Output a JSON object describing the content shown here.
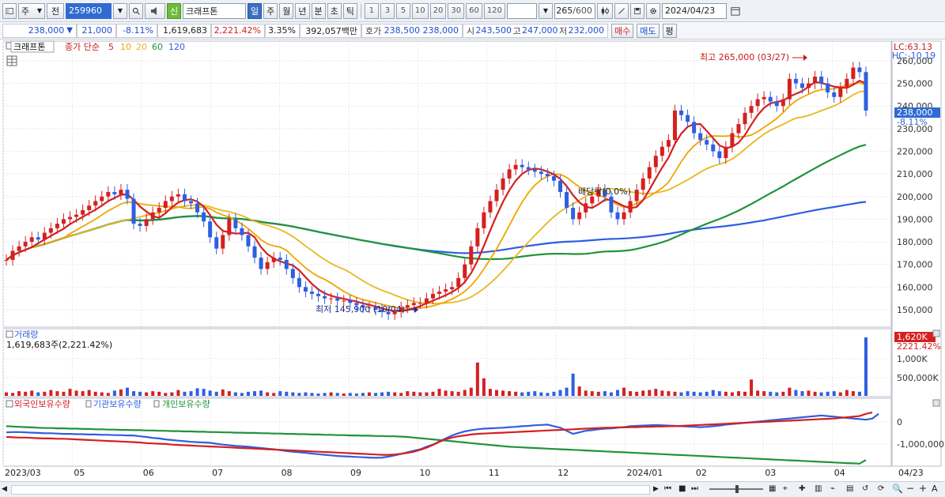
{
  "toolbar": {
    "period_type": "주",
    "prev_label": "전",
    "code": "259960",
    "stock_badge": "신",
    "stock_name": "크래프톤",
    "tabs": [
      "일",
      "주",
      "월",
      "년",
      "분",
      "초",
      "틱"
    ],
    "selected_tab": "일",
    "intervals": [
      "1",
      "3",
      "5",
      "10",
      "20",
      "30",
      "60",
      "120"
    ],
    "count": "265",
    "count_total": "/600",
    "date": "2024/04/23"
  },
  "quote": {
    "price": "238,000",
    "change": "21,000",
    "rate": "-8.11%",
    "volume": "1,619,683",
    "volume_rate": "2,221.42%",
    "turnover": "3.35%",
    "amount": "392,057백만",
    "ask_label": "호가",
    "ask": "238,500",
    "bid": "238,000",
    "open_label": "시",
    "open": "243,500",
    "high_label": "고",
    "high": "247,000",
    "low_label": "저",
    "low": "232,000",
    "buy_label": "매수",
    "sell_label": "매도",
    "eval_label": "평"
  },
  "price_panel": {
    "name": "크래프톤",
    "ma_label": "종가 단순",
    "ma_periods": [
      "5",
      "10",
      "20",
      "60",
      "120"
    ],
    "ma_colors": [
      "#d42020",
      "#f0a400",
      "#e8b820",
      "#21933a",
      "#2f5fe0"
    ],
    "lc": "LC:63.13",
    "hc": "HC:-10.19",
    "high_note": "최고 265,000 (03/27)",
    "low_note": "최저 145,900 (10/04)",
    "dividend_note": "배당락(0.0%)",
    "current_price_tag": "238,000",
    "current_rate_tag": "-8.11%",
    "y_ticks": [
      "260,000",
      "250,000",
      "240,000",
      "230,000",
      "220,000",
      "210,000",
      "200,000",
      "190,000",
      "180,000",
      "170,000",
      "160,000",
      "150,000"
    ]
  },
  "volume_panel": {
    "title": "거래량",
    "value_text": "1,619,683주(2,221.42%)",
    "tag_value": "1,620K",
    "tag_rate": "2221.42%",
    "y_ticks": [
      "1,000K",
      "500,000K"
    ]
  },
  "holdings_panel": {
    "series": [
      "외국인보유수량",
      "기관보유수량",
      "개인보유수량"
    ],
    "y_ticks": [
      "0",
      "-1,000,000"
    ]
  },
  "x_axis": {
    "labels": [
      "2023/03",
      "05",
      "06",
      "07",
      "08",
      "09",
      "10",
      "11",
      "12",
      "2024/01",
      "02",
      "03",
      "04"
    ],
    "right_label": "04/23"
  },
  "chart_data": {
    "type": "candlestick",
    "title": "크래프톤",
    "ylim": [
      143000,
      268000
    ],
    "price_close": [
      172000,
      176000,
      178000,
      180000,
      182000,
      181000,
      184000,
      186000,
      188000,
      190000,
      191000,
      192000,
      194000,
      196000,
      198000,
      200000,
      202000,
      201000,
      203000,
      199000,
      188000,
      187000,
      190000,
      193000,
      195000,
      198000,
      200000,
      201000,
      198000,
      197000,
      193000,
      189000,
      182000,
      177000,
      183000,
      190000,
      186000,
      183000,
      178000,
      173000,
      168000,
      171000,
      173000,
      172000,
      168000,
      164000,
      160000,
      158000,
      157000,
      156000,
      155000,
      155000,
      154000,
      154000,
      153000,
      152000,
      151000,
      151000,
      150000,
      149000,
      148000,
      149000,
      151000,
      152000,
      153000,
      153000,
      155000,
      157000,
      158000,
      159000,
      160000,
      164000,
      170000,
      178000,
      186000,
      193000,
      198000,
      203000,
      208000,
      212000,
      214000,
      213000,
      212000,
      211000,
      210000,
      209000,
      207000,
      202000,
      195000,
      190000,
      193000,
      197000,
      200000,
      203000,
      200000,
      193000,
      190000,
      193000,
      198000,
      203000,
      208000,
      213000,
      218000,
      222000,
      225000,
      238000,
      236000,
      233000,
      228000,
      225000,
      223000,
      220000,
      217000,
      222000,
      228000,
      232000,
      237000,
      240000,
      243000,
      244000,
      242000,
      240000,
      243000,
      252000,
      250000,
      248000,
      250000,
      253000,
      250000,
      246000,
      244000,
      248000,
      252000,
      257000,
      255000,
      238000
    ],
    "volume_rel": [
      0.06,
      0.05,
      0.08,
      0.07,
      0.09,
      0.06,
      0.07,
      0.1,
      0.08,
      0.07,
      0.12,
      0.09,
      0.08,
      0.1,
      0.07,
      0.06,
      0.05,
      0.09,
      0.11,
      0.14,
      0.08,
      0.07,
      0.06,
      0.08,
      0.07,
      0.05,
      0.06,
      0.1,
      0.07,
      0.08,
      0.13,
      0.12,
      0.09,
      0.07,
      0.11,
      0.08,
      0.06,
      0.05,
      0.07,
      0.08,
      0.09,
      0.06,
      0.05,
      0.08,
      0.07,
      0.06,
      0.05,
      0.06,
      0.05,
      0.04,
      0.05,
      0.06,
      0.05,
      0.04,
      0.05,
      0.04,
      0.05,
      0.06,
      0.05,
      0.06,
      0.07,
      0.06,
      0.05,
      0.08,
      0.07,
      0.06,
      0.06,
      0.07,
      0.12,
      0.09,
      0.08,
      0.07,
      0.1,
      0.14,
      0.57,
      0.3,
      0.12,
      0.1,
      0.09,
      0.08,
      0.07,
      0.06,
      0.07,
      0.08,
      0.06,
      0.05,
      0.07,
      0.1,
      0.14,
      0.38,
      0.16,
      0.09,
      0.08,
      0.07,
      0.08,
      0.06,
      0.1,
      0.14,
      0.08,
      0.07,
      0.09,
      0.1,
      0.12,
      0.09,
      0.08,
      0.07,
      0.06,
      0.08,
      0.07,
      0.06,
      0.07,
      0.1,
      0.08,
      0.07,
      0.06,
      0.08,
      0.07,
      0.28,
      0.09,
      0.08,
      0.07,
      0.06,
      0.07,
      0.14,
      0.1,
      0.08,
      0.09,
      0.07,
      0.06,
      0.07,
      0.08,
      0.06,
      0.1,
      0.08,
      0.07,
      1.0
    ],
    "holdings": {
      "foreign_rel": [
        0.2,
        0.19,
        0.18,
        0.18,
        0.17,
        0.16,
        0.15,
        0.15,
        0.14,
        0.14,
        0.13,
        0.12,
        0.11,
        0.1,
        0.09,
        0.08,
        0.07,
        0.06,
        0.05,
        0.04,
        0.03,
        0.02,
        0.0,
        -0.01,
        -0.02,
        -0.03,
        -0.05,
        -0.06,
        -0.07,
        -0.08,
        -0.09,
        -0.1,
        -0.11,
        -0.12,
        -0.13,
        -0.14,
        -0.15,
        -0.16,
        -0.17,
        -0.18,
        -0.19,
        -0.2,
        -0.21,
        -0.22,
        -0.23,
        -0.24,
        -0.25,
        -0.26,
        -0.27,
        -0.28,
        -0.29,
        -0.3,
        -0.31,
        -0.32,
        -0.33,
        -0.34,
        -0.35,
        -0.36,
        -0.37,
        -0.38,
        -0.38,
        -0.37,
        -0.35,
        -0.32,
        -0.28,
        -0.22,
        -0.15,
        -0.06,
        0.04,
        0.12,
        0.18,
        0.22,
        0.25,
        0.28,
        0.3,
        0.31,
        0.32,
        0.33,
        0.34,
        0.35,
        0.36,
        0.37,
        0.38,
        0.39,
        0.4,
        0.41,
        0.42,
        0.43,
        0.44,
        0.45,
        0.46,
        0.47,
        0.48,
        0.49,
        0.5,
        0.5,
        0.51,
        0.51,
        0.52,
        0.52,
        0.53,
        0.53,
        0.54,
        0.54,
        0.55,
        0.55,
        0.56,
        0.57,
        0.58,
        0.59,
        0.6,
        0.61,
        0.62,
        0.63,
        0.64,
        0.65,
        0.66,
        0.67,
        0.68,
        0.69,
        0.7,
        0.71,
        0.72,
        0.73,
        0.74,
        0.75,
        0.76,
        0.77,
        0.78,
        0.79,
        0.8,
        0.82,
        0.84,
        0.86,
        0.88,
        0.95,
        1.0
      ],
      "institution_rel": [
        0.35,
        0.36,
        0.36,
        0.35,
        0.34,
        0.33,
        0.32,
        0.32,
        0.31,
        0.3,
        0.3,
        0.29,
        0.29,
        0.28,
        0.28,
        0.27,
        0.27,
        0.26,
        0.26,
        0.25,
        0.25,
        0.22,
        0.2,
        0.17,
        0.15,
        0.12,
        0.1,
        0.08,
        0.06,
        0.04,
        0.03,
        0.02,
        0.01,
        -0.02,
        -0.05,
        -0.07,
        -0.09,
        -0.1,
        -0.12,
        -0.14,
        -0.16,
        -0.18,
        -0.2,
        -0.23,
        -0.26,
        -0.28,
        -0.3,
        -0.32,
        -0.34,
        -0.36,
        -0.38,
        -0.4,
        -0.42,
        -0.43,
        -0.44,
        -0.45,
        -0.46,
        -0.47,
        -0.48,
        -0.47,
        -0.44,
        -0.4,
        -0.35,
        -0.3,
        -0.25,
        -0.2,
        -0.12,
        -0.05,
        0.05,
        0.15,
        0.25,
        0.32,
        0.38,
        0.42,
        0.45,
        0.47,
        0.48,
        0.49,
        0.5,
        0.52,
        0.53,
        0.55,
        0.56,
        0.58,
        0.59,
        0.6,
        0.55,
        0.5,
        0.4,
        0.3,
        0.35,
        0.4,
        0.42,
        0.45,
        0.47,
        0.48,
        0.5,
        0.52,
        0.55,
        0.56,
        0.57,
        0.58,
        0.59,
        0.58,
        0.57,
        0.56,
        0.55,
        0.54,
        0.53,
        0.52,
        0.53,
        0.55,
        0.57,
        0.6,
        0.62,
        0.64,
        0.66,
        0.68,
        0.7,
        0.72,
        0.74,
        0.76,
        0.78,
        0.8,
        0.82,
        0.84,
        0.86,
        0.88,
        0.9,
        0.88,
        0.86,
        0.84,
        0.82,
        0.8,
        0.78,
        0.76,
        0.8,
        0.95
      ],
      "individual_rel": [
        0.55,
        0.54,
        0.53,
        0.52,
        0.51,
        0.5,
        0.49,
        0.49,
        0.48,
        0.48,
        0.47,
        0.47,
        0.46,
        0.46,
        0.45,
        0.45,
        0.44,
        0.44,
        0.43,
        0.43,
        0.42,
        0.42,
        0.41,
        0.41,
        0.4,
        0.4,
        0.39,
        0.39,
        0.38,
        0.38,
        0.37,
        0.37,
        0.36,
        0.36,
        0.35,
        0.35,
        0.34,
        0.34,
        0.33,
        0.33,
        0.32,
        0.32,
        0.31,
        0.31,
        0.3,
        0.3,
        0.29,
        0.29,
        0.28,
        0.28,
        0.27,
        0.27,
        0.26,
        0.26,
        0.25,
        0.25,
        0.24,
        0.24,
        0.23,
        0.23,
        0.22,
        0.22,
        0.21,
        0.2,
        0.18,
        0.16,
        0.14,
        0.12,
        0.1,
        0.08,
        0.06,
        0.04,
        0.02,
        0.0,
        -0.02,
        -0.04,
        -0.06,
        -0.08,
        -0.1,
        -0.12,
        -0.13,
        -0.14,
        -0.15,
        -0.16,
        -0.17,
        -0.18,
        -0.19,
        -0.2,
        -0.21,
        -0.22,
        -0.23,
        -0.24,
        -0.25,
        -0.26,
        -0.27,
        -0.28,
        -0.29,
        -0.3,
        -0.31,
        -0.32,
        -0.33,
        -0.34,
        -0.35,
        -0.36,
        -0.37,
        -0.38,
        -0.39,
        -0.4,
        -0.41,
        -0.42,
        -0.43,
        -0.44,
        -0.45,
        -0.46,
        -0.47,
        -0.48,
        -0.49,
        -0.5,
        -0.51,
        -0.52,
        -0.53,
        -0.54,
        -0.55,
        -0.56,
        -0.57,
        -0.58,
        -0.59,
        -0.6,
        -0.61,
        -0.62,
        -0.63,
        -0.64,
        -0.65,
        -0.66,
        -0.67,
        -0.55
      ]
    }
  }
}
